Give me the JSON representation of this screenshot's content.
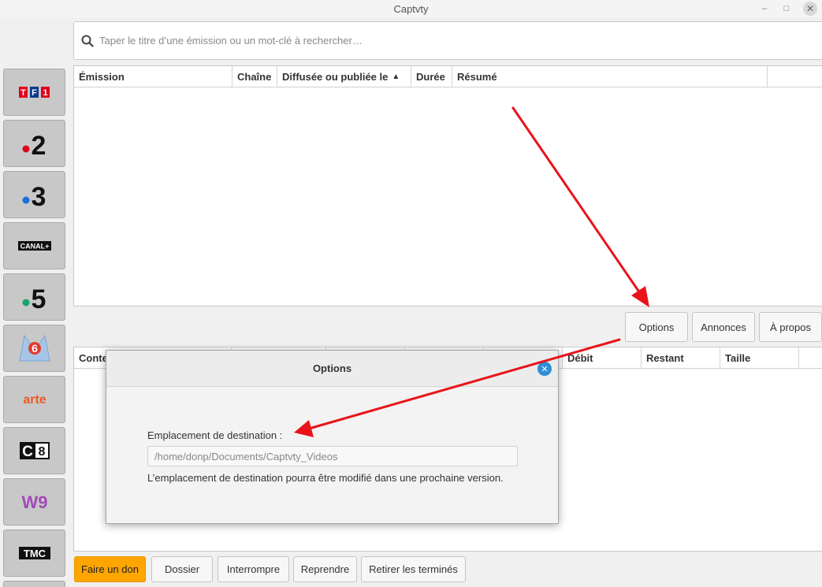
{
  "window": {
    "title": "Captvty"
  },
  "search": {
    "placeholder": "Taper le titre d’une émission ou un mot-clé à rechercher…"
  },
  "channels": [
    {
      "name": "TF1",
      "label": "TF1"
    },
    {
      "name": "France 2",
      "label": "2"
    },
    {
      "name": "France 3",
      "label": "3"
    },
    {
      "name": "Canal+",
      "label": "CANAL+"
    },
    {
      "name": "France 5",
      "label": "5"
    },
    {
      "name": "M6",
      "label": "6"
    },
    {
      "name": "Arte",
      "label": "arte"
    },
    {
      "name": "C8",
      "label": "8"
    },
    {
      "name": "W9",
      "label": "W9"
    },
    {
      "name": "TMC",
      "label": "TMC"
    }
  ],
  "programs_table": {
    "columns": [
      "Émission",
      "Chaîne",
      "Diffusée ou publiée le",
      "Durée",
      "Résumé"
    ]
  },
  "top_buttons": {
    "options": "Options",
    "annonces": "Annonces",
    "apropos": "À propos"
  },
  "downloads_table": {
    "columns": [
      "Conte",
      "Débit",
      "Restant",
      "Taille"
    ]
  },
  "bottom_buttons": {
    "donate": "Faire un don",
    "folder": "Dossier",
    "interrupt": "Interrompre",
    "resume": "Reprendre",
    "clear": "Retirer les terminés"
  },
  "options_dialog": {
    "title": "Options",
    "destination_label": "Emplacement de destination :",
    "destination_value": "/home/donp/Documents/Captvty_Videos",
    "note": "L’emplacement de destination pourra être modifié dans une prochaine version."
  },
  "colors": {
    "accent_orange": "#ffa500",
    "arrow_red": "#e8141a",
    "dialog_close_blue": "#2e8fd6"
  }
}
